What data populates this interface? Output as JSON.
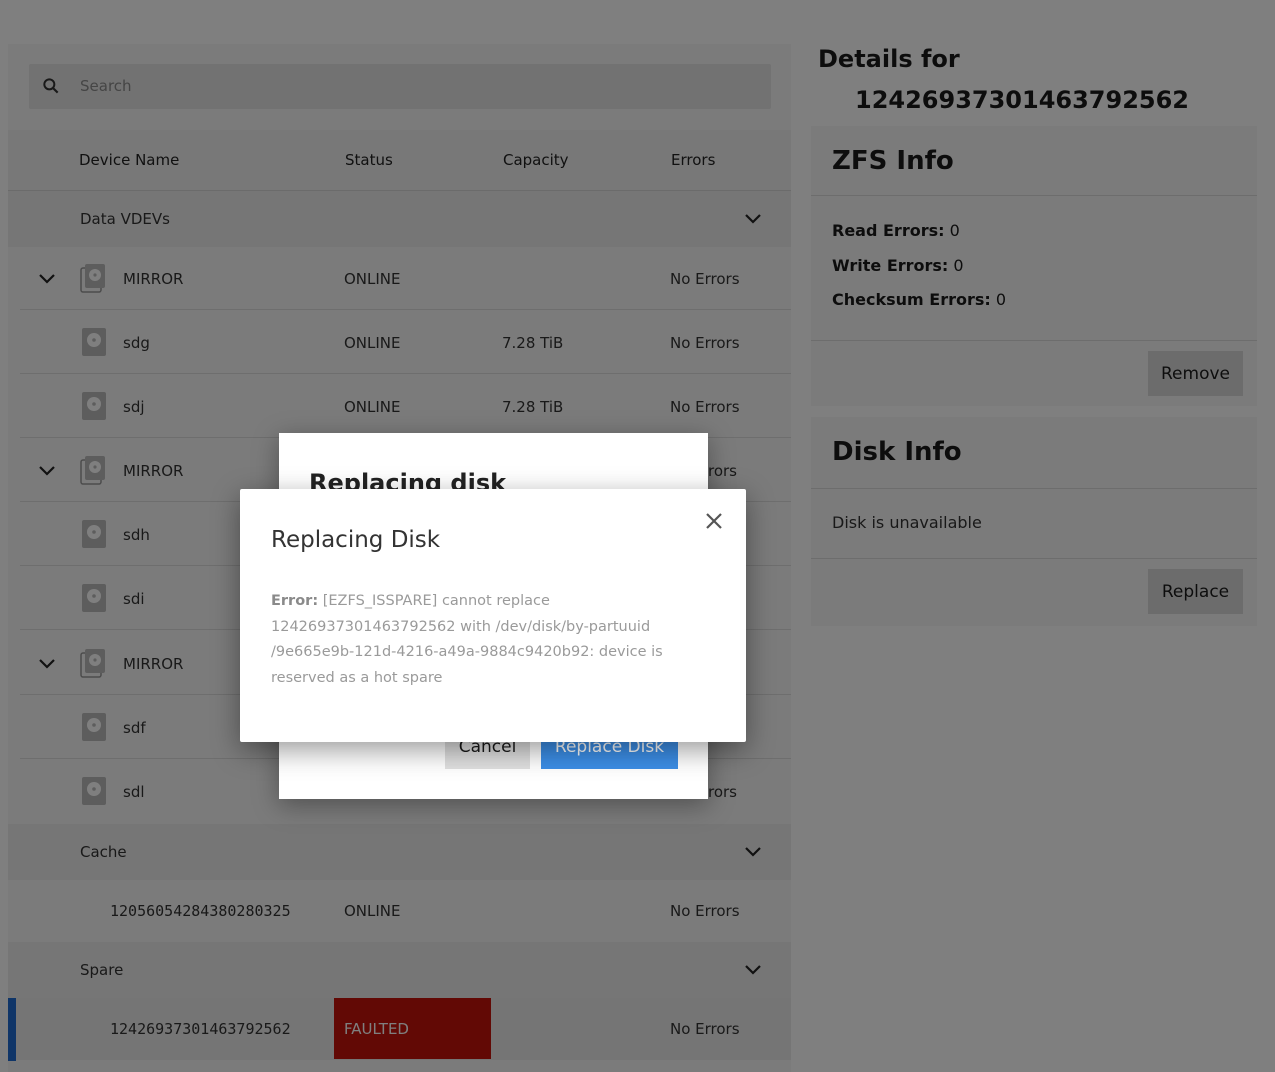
{
  "search": {
    "placeholder": "Search"
  },
  "table": {
    "columns": [
      "Device Name",
      "Status",
      "Capacity",
      "Errors"
    ],
    "groups": {
      "data_vdevs": "Data VDEVs",
      "cache": "Cache",
      "spare": "Spare"
    },
    "rows": [
      {
        "name": "MIRROR",
        "status": "ONLINE",
        "capacity": "",
        "errors": "No Errors"
      },
      {
        "name": "sdg",
        "status": "ONLINE",
        "capacity": "7.28 TiB",
        "errors": "No Errors"
      },
      {
        "name": "sdj",
        "status": "ONLINE",
        "capacity": "7.28 TiB",
        "errors": "No Errors"
      },
      {
        "name": "MIRROR",
        "status": "",
        "capacity": "",
        "errors": "rors"
      },
      {
        "name": "sdh",
        "status": "",
        "capacity": "",
        "errors": ""
      },
      {
        "name": "sdi",
        "status": "",
        "capacity": "",
        "errors": ""
      },
      {
        "name": "MIRROR",
        "status": "",
        "capacity": "",
        "errors": ""
      },
      {
        "name": "sdf",
        "status": "",
        "capacity": "",
        "errors": ""
      },
      {
        "name": "sdl",
        "status": "",
        "capacity": "",
        "errors": "rors"
      },
      {
        "name": "12056054284380280325",
        "status": "ONLINE",
        "capacity": "",
        "errors": "No Errors"
      },
      {
        "name": "12426937301463792562",
        "status": "FAULTED",
        "capacity": "",
        "errors": "No Errors"
      }
    ]
  },
  "details": {
    "title_prefix": "Details for",
    "device_id": "12426937301463792562",
    "zfs_info": {
      "title": "ZFS Info",
      "read_label": "Read Errors:",
      "read_value": "0",
      "write_label": "Write Errors:",
      "write_value": "0",
      "checksum_label": "Checksum Errors:",
      "checksum_value": "0",
      "remove_button": "Remove"
    },
    "disk_info": {
      "title": "Disk Info",
      "message": "Disk is unavailable",
      "replace_button": "Replace"
    }
  },
  "back_dialog": {
    "title": "Replacing disk",
    "cancel_button": "Cancel",
    "confirm_button": "Replace Disk"
  },
  "error_dialog": {
    "title": "Replacing Disk",
    "error_label": "Error:",
    "message_line1": " [EZFS_ISSPARE] cannot replace",
    "message_line2": "12426937301463792562 with /dev/disk/by-partuuid",
    "message_line3": "/9e665e9b-121d-4216-a49a-9884c9420b92: device is",
    "message_line4": "reserved as a hot spare"
  },
  "colors": {
    "faulted": "#c5130b",
    "primary": "#1f6bd1"
  }
}
